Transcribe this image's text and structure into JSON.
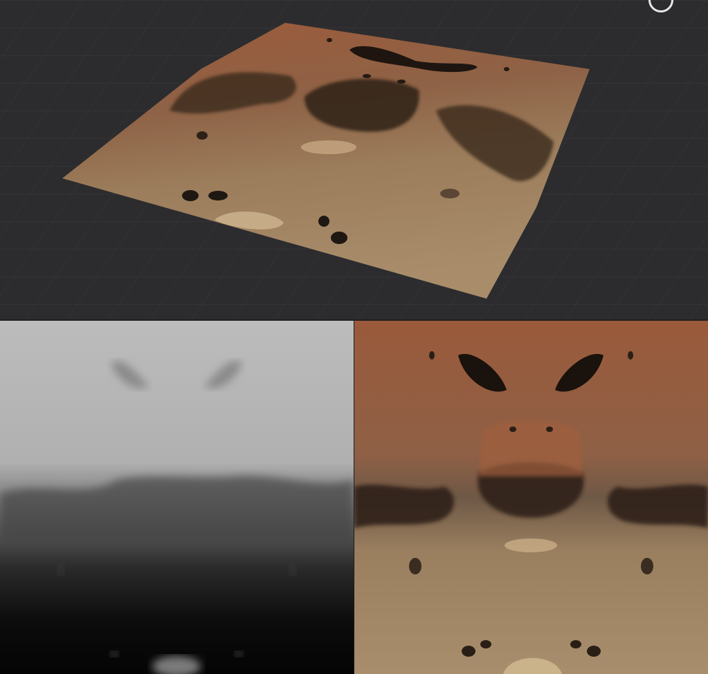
{
  "viewport": {
    "background": "#2c2c2e",
    "grid_color": "#3a3a3d",
    "gizmo_icon": "orbit-gizmo-icon"
  },
  "panels": {
    "heightmap": {
      "icon": "heightmap-preview"
    },
    "texture": {
      "icon": "albedo-texture-preview"
    }
  },
  "colors": {
    "rock_top": "#9a5a3a",
    "sand": "#a08462",
    "shadow": "#2a1d14",
    "height_high": "#bdbdbd",
    "height_low": "#050505"
  }
}
